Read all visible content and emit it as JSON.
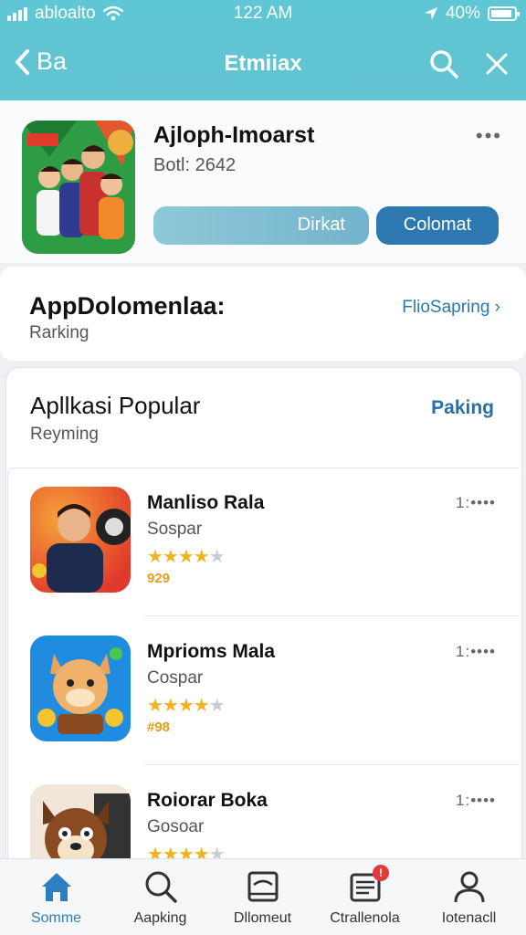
{
  "status_bar": {
    "carrier": "abloalto",
    "time": "122 AM",
    "battery": "40%"
  },
  "header": {
    "back_label": "Ba",
    "title": "Etmiiax"
  },
  "app": {
    "name": "Ajloph-Imoarst",
    "subtitle": "Botl: 2642",
    "more": "•••",
    "button_secondary": "Dirkat",
    "button_primary": "Colomat"
  },
  "section_top": {
    "title": "AppDolomenlaa:",
    "subtitle": "Rarking",
    "link": "FlioSapring ›"
  },
  "section_popular": {
    "title": "Apllkasi Popular",
    "subtitle": "Reyming",
    "link": "Paking",
    "items": [
      {
        "name": "Manliso Rala",
        "category": "Sospar",
        "rating": 3.5,
        "count": "929",
        "rank": "1:••••"
      },
      {
        "name": "Mprioms Mala",
        "category": "Cospar",
        "rating": 3.5,
        "count": "#98",
        "rank": "1:••••"
      },
      {
        "name": "Roiorar Boka",
        "category": "Gosoar",
        "rating": 4,
        "count": "",
        "rank": "1:••••"
      }
    ]
  },
  "tabbar": {
    "items": [
      {
        "label": "Somme",
        "icon": "home-icon",
        "active": true
      },
      {
        "label": "Aapking",
        "icon": "search-icon",
        "active": false
      },
      {
        "label": "Dllomeut",
        "icon": "inbox-icon",
        "active": false
      },
      {
        "label": "Ctrallenola",
        "icon": "list-icon",
        "active": false,
        "badge": "!"
      },
      {
        "label": "Iotenacll",
        "icon": "person-icon",
        "active": false
      }
    ]
  },
  "colors": {
    "header": "#5ec6d4",
    "primary_button": "#2d78b0",
    "accent": "#2a78b0",
    "star": "#f3b31f"
  }
}
